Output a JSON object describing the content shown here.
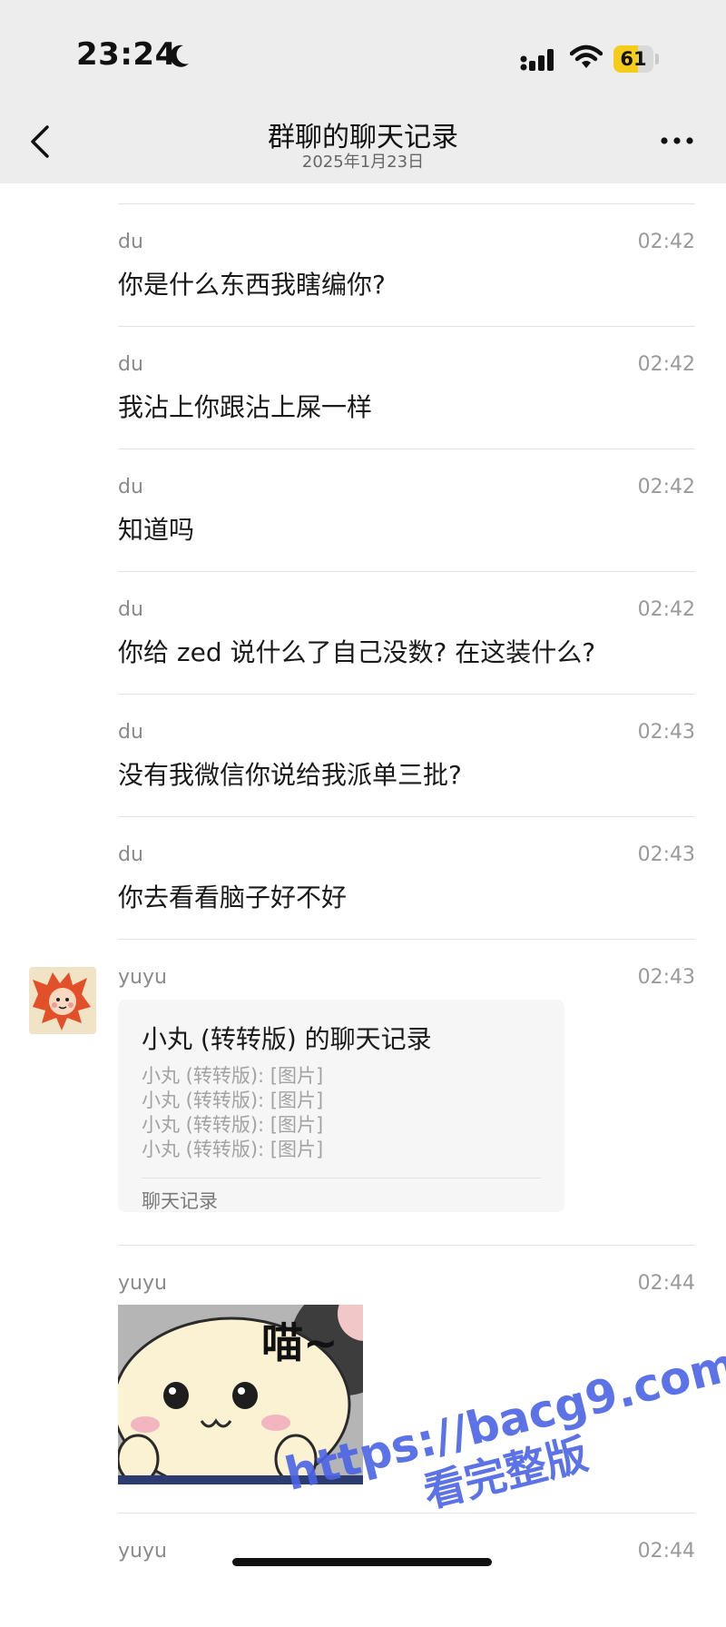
{
  "status_bar": {
    "time": "23:24",
    "battery_level": "61",
    "battery_fraction": 0.61,
    "icons": [
      "moon-icon",
      "signal-icon",
      "wifi-icon",
      "battery-icon"
    ]
  },
  "nav": {
    "title": "群聊的聊天记录",
    "subtitle": "2025年1月23日",
    "back_icon": "chevron-left-icon",
    "more_icon": "more-icon"
  },
  "messages": [
    {
      "sender": "du",
      "time": "02:42",
      "text": "你是什么东西我瞎编你?"
    },
    {
      "sender": "du",
      "time": "02:42",
      "text": "我沾上你跟沾上屎一样"
    },
    {
      "sender": "du",
      "time": "02:42",
      "text": "知道吗"
    },
    {
      "sender": "du",
      "time": "02:42",
      "text": "你给 zed 说什么了自己没数? 在这装什么?"
    },
    {
      "sender": "du",
      "time": "02:43",
      "text": "没有我微信你说给我派单三批?"
    },
    {
      "sender": "du",
      "time": "02:43",
      "text": "你去看看脑子好不好"
    },
    {
      "sender": "yuyu",
      "time": "02:43",
      "record": {
        "title": "小丸 (转转版) 的聊天记录",
        "lines": [
          "小丸 (转转版): [图片]",
          "小丸 (转转版): [图片]",
          "小丸 (转转版): [图片]",
          "小丸 (转转版): [图片]"
        ],
        "footer": "聊天记录"
      }
    },
    {
      "sender": "yuyu",
      "time": "02:44",
      "sticker_text": "喵~"
    },
    {
      "sender": "yuyu",
      "time": "02:44"
    }
  ],
  "watermark": {
    "line1": "https://bacg9.com",
    "line2": "看完整版"
  }
}
